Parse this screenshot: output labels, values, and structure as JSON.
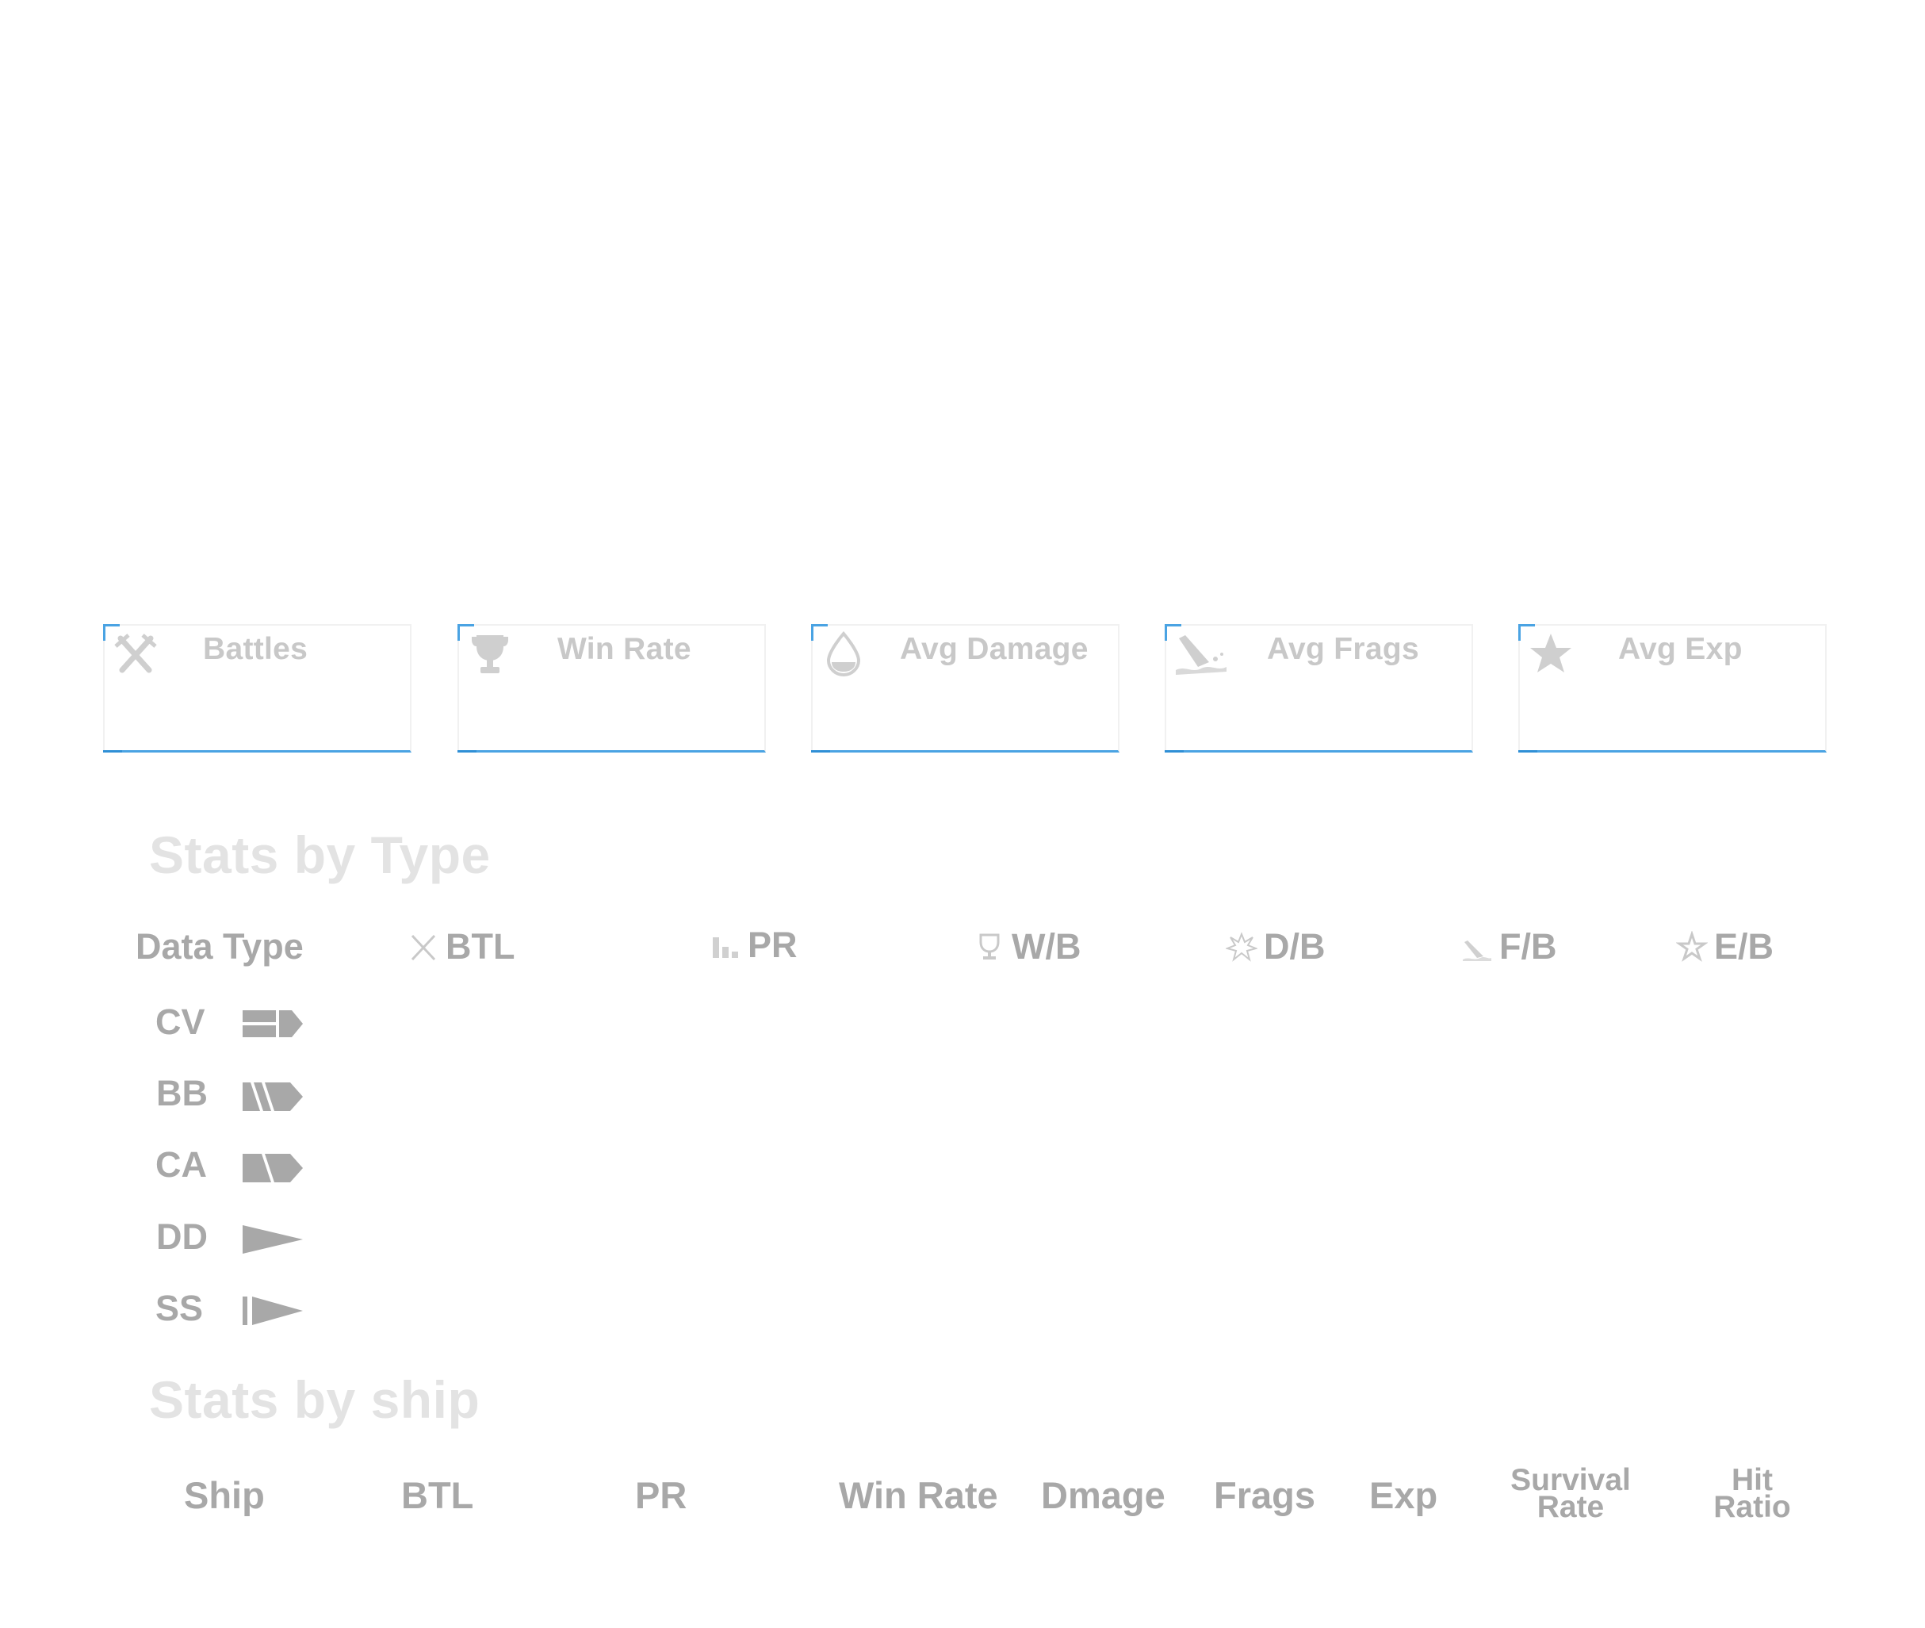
{
  "cards": [
    {
      "label": "Battles",
      "icon": "crossed-swords-icon"
    },
    {
      "label": "Win Rate",
      "icon": "trophy-icon"
    },
    {
      "label": "Avg Damage",
      "icon": "drop-icon"
    },
    {
      "label": "Avg Frags",
      "icon": "sinking-ship-icon"
    },
    {
      "label": "Avg Exp",
      "icon": "star-icon"
    }
  ],
  "stats_by_type": {
    "title": "Stats by Type",
    "headers": {
      "data_type": "Data Type",
      "btl": "BTL",
      "pr": "PR",
      "wb": "W/B",
      "db": "D/B",
      "fb": "F/B",
      "eb": "E/B"
    },
    "rows": [
      {
        "label": "CV",
        "icon": "carrier-icon"
      },
      {
        "label": "BB",
        "icon": "battleship-icon"
      },
      {
        "label": "CA",
        "icon": "cruiser-icon"
      },
      {
        "label": "DD",
        "icon": "destroyer-icon"
      },
      {
        "label": "SS",
        "icon": "submarine-icon"
      }
    ]
  },
  "stats_by_ship": {
    "title": "Stats by ship",
    "headers": {
      "ship": "Ship",
      "btl": "BTL",
      "pr": "PR",
      "win_rate": "Win Rate",
      "damage": "Dmage",
      "frags": "Frags",
      "exp": "Exp",
      "survival_1": "Survival",
      "survival_2": "Rate",
      "hit_1": "Hit",
      "hit_2": "Ratio"
    }
  },
  "colors": {
    "accent": "#4aa3e3",
    "header_text": "#a8a8a8",
    "card_label": "#c8c8c8",
    "section_title": "#e3e3e3"
  }
}
